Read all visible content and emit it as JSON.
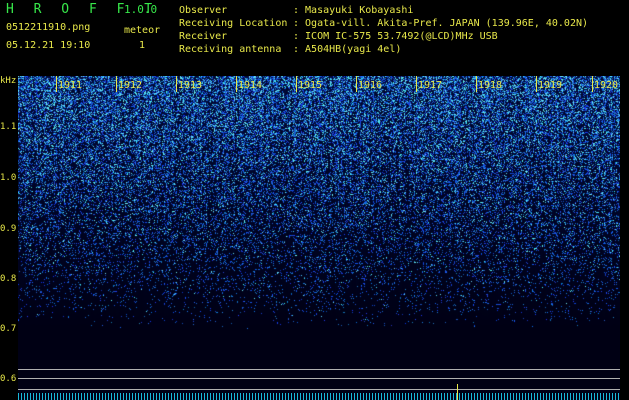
{
  "header": {
    "app_title": "H R O F F T",
    "app_version": "1.0.0",
    "file_name": "0512211910.png",
    "meteor_label": "meteor",
    "datetime": "05.12.21 19:10",
    "meteor_count": "1",
    "info": [
      {
        "key": "Observer",
        "value": ": Masayuki Kobayashi"
      },
      {
        "key": "Receiving Location",
        "value": ": Ogata-vill. Akita-Pref. JAPAN (139.96E, 40.02N)"
      },
      {
        "key": "Receiver",
        "value": ": ICOM IC-575 53.7492(@LCD)MHz USB"
      },
      {
        "key": "Receiving antenna",
        "value": ": A504HB(yagi 4el)"
      }
    ]
  },
  "axis": {
    "unit": "kHz",
    "freq_ticks": [
      "1.1",
      "1.0",
      "0.9",
      "0.8",
      "0.7",
      "0.6"
    ],
    "time_ticks": [
      "1911",
      "1912",
      "1913",
      "1914",
      "1915",
      "1916",
      "1917",
      "1918",
      "1919",
      "1920"
    ]
  },
  "colors": {
    "label": "#e8e84a",
    "title": "#37e84a",
    "noise_high": "#5adcff",
    "noise_low": "#1a3cc8"
  }
}
